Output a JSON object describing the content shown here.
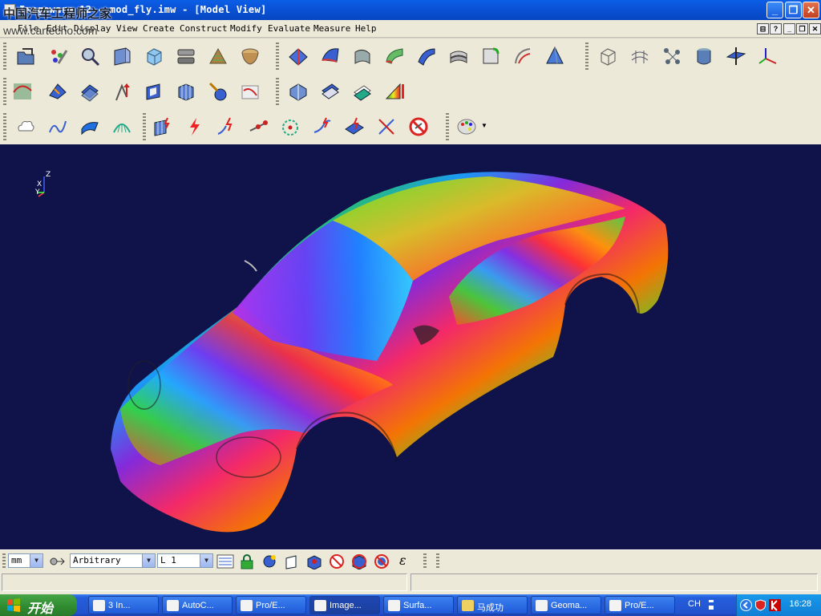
{
  "window": {
    "title": "Imageware 12 - mod_fly.imw - [Model View]",
    "watermark": "中国汽车工程师之家",
    "watermark_url": "www.cartecho.com",
    "controls": [
      "_",
      "❐",
      "✕"
    ]
  },
  "menubar": {
    "items": [
      "File",
      "Edit",
      "Display",
      "View",
      "Create",
      "Construct",
      "Modify",
      "Evaluate",
      "Measure",
      "Help"
    ]
  },
  "toolbars": {
    "row1": [
      "open-file",
      "sample-points",
      "zoom-probe",
      "plane-view",
      "box-view",
      "display-mode",
      "point-cloud",
      "mesh-shell",
      "surface-plane",
      "surface-twist",
      "surface-sweep",
      "surface-blend",
      "surface-extend",
      "surface-offset",
      "surface-fillet",
      "curve-on-surface",
      "cone-solid",
      "bounding-box",
      "wire-frame",
      "node-graph",
      "cylinder-solid",
      "section-plane",
      "coordinate-axes"
    ],
    "row2": [
      "curve-shade",
      "surface-trim",
      "surface-stack",
      "vector-arrows",
      "frame-window",
      "grid-box",
      "sphere-pick",
      "check-curve",
      "surface-patch",
      "surface-layers",
      "surface-flat",
      "color-map"
    ],
    "row3": [
      "cloud-points",
      "free-curve",
      "surface-patch-blue",
      "arc-fan",
      "grid-lightning",
      "lightning",
      "curve-lightning",
      "point-link",
      "circle-points",
      "curve-align",
      "surface-align",
      "cross-tool",
      "no-entry",
      "palette-more"
    ]
  },
  "viewport": {
    "background": "#10124a",
    "axis_labels": [
      "Z",
      "X",
      "Y"
    ]
  },
  "statusbar": {
    "units_value": "mm",
    "view_mode_value": "Arbitrary",
    "layer_value": "L 1",
    "epsilon": "ε"
  },
  "taskbar": {
    "start_label": "开始",
    "tasks": [
      "3 In...",
      "AutoC...",
      "Pro/E...",
      "Image...",
      "Surfa...",
      "马成功",
      "Geoma...",
      "Pro/E..."
    ],
    "active_task_index": 3,
    "language": "CH",
    "clock": "16:28"
  }
}
